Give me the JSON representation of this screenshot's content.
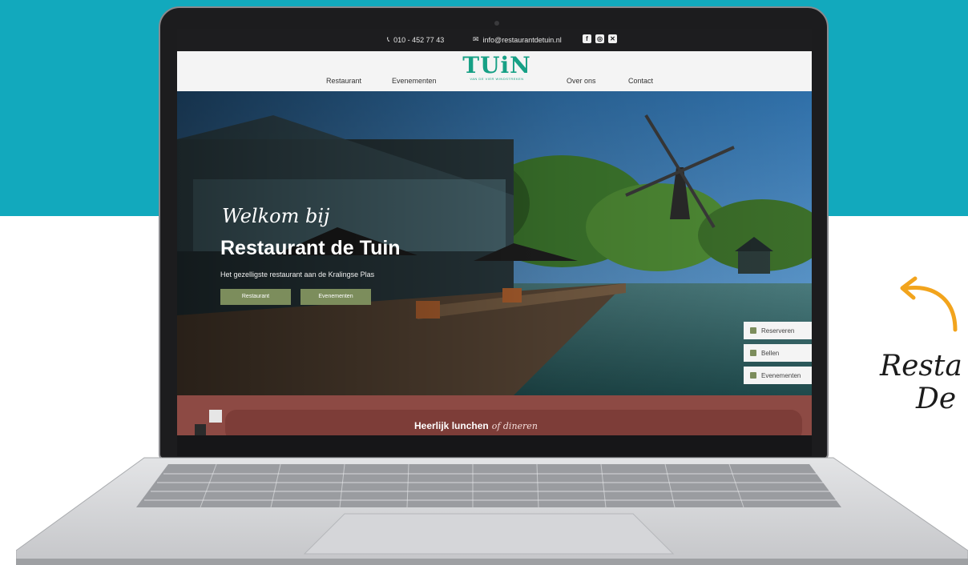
{
  "site": {
    "topbar": {
      "phone": "010 - 452 77 43",
      "email": "info@restaurantdetuin.nl",
      "social": [
        {
          "name": "facebook-icon",
          "glyph": "f"
        },
        {
          "name": "instagram-icon",
          "glyph": "◎"
        },
        {
          "name": "x-icon",
          "glyph": "✕"
        }
      ]
    },
    "nav": {
      "left": [
        "Restaurant",
        "Evenementen"
      ],
      "right": [
        "Over ons",
        "Contact"
      ],
      "logo_word": "TUiN",
      "logo_sub": "VAN DE VIER WINDSTREKEN"
    },
    "hero": {
      "welcome": "Welkom bij",
      "title": "Restaurant de Tuin",
      "subtitle": "Het gezelligste restaurant aan de Kralingse Plas",
      "buttons": [
        "Restaurant",
        "Evenementen"
      ]
    },
    "side_actions": [
      {
        "label": "Reserveren",
        "icon": "calendar-icon"
      },
      {
        "label": "Bellen",
        "icon": "phone-icon"
      },
      {
        "label": "Evenementen",
        "icon": "cocktail-icon"
      }
    ],
    "lunch": {
      "bold": "Heerlijk lunchen",
      "script": "of dineren"
    }
  },
  "caption": {
    "line1": "Resta",
    "line2": "De"
  },
  "colors": {
    "backdrop": "#12a9bd",
    "brand_green": "#16a085",
    "button_olive": "#7c8d5c",
    "lunch_red": "#8d4a44",
    "arrow_orange": "#f2a41d"
  }
}
